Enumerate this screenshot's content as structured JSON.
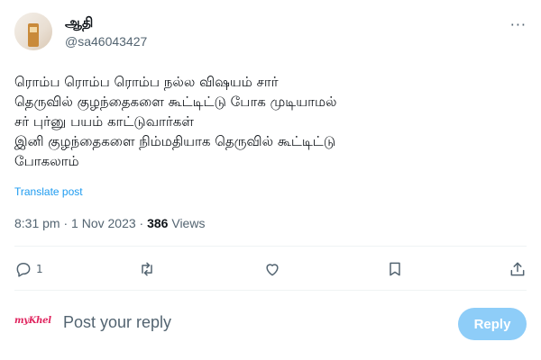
{
  "author": {
    "name": "ஆதி",
    "handle": "@sa46043427"
  },
  "more_label": "···",
  "post": {
    "lines": [
      "ரொம்ப ரொம்ப ரொம்ப நல்ல விஷயம் சார்",
      "தெருவில் குழந்தைகளை கூட்டிட்டு போக முடியாமல்",
      "சர் புர்னு பயம் காட்டுவார்கள்",
      "இனி குழந்தைகளை நிம்மதியாக தெருவில் கூட்டிட்டு",
      "போகலாம்"
    ],
    "translate_label": "Translate post"
  },
  "meta": {
    "time": "8:31 pm",
    "separator": "·",
    "date": "1 Nov 2023",
    "views_count": "386",
    "views_label": "Views"
  },
  "actions": {
    "reply_count": "1",
    "icons": [
      "reply-icon",
      "repost-icon",
      "like-icon",
      "bookmark-icon",
      "share-icon"
    ]
  },
  "reply_box": {
    "logo_text": "myKhel",
    "placeholder": "Post your reply",
    "button_label": "Reply"
  },
  "colors": {
    "accent": "#1d9bf0",
    "reply_button_disabled": "#8ecdf8",
    "secondary_text": "#536471"
  }
}
